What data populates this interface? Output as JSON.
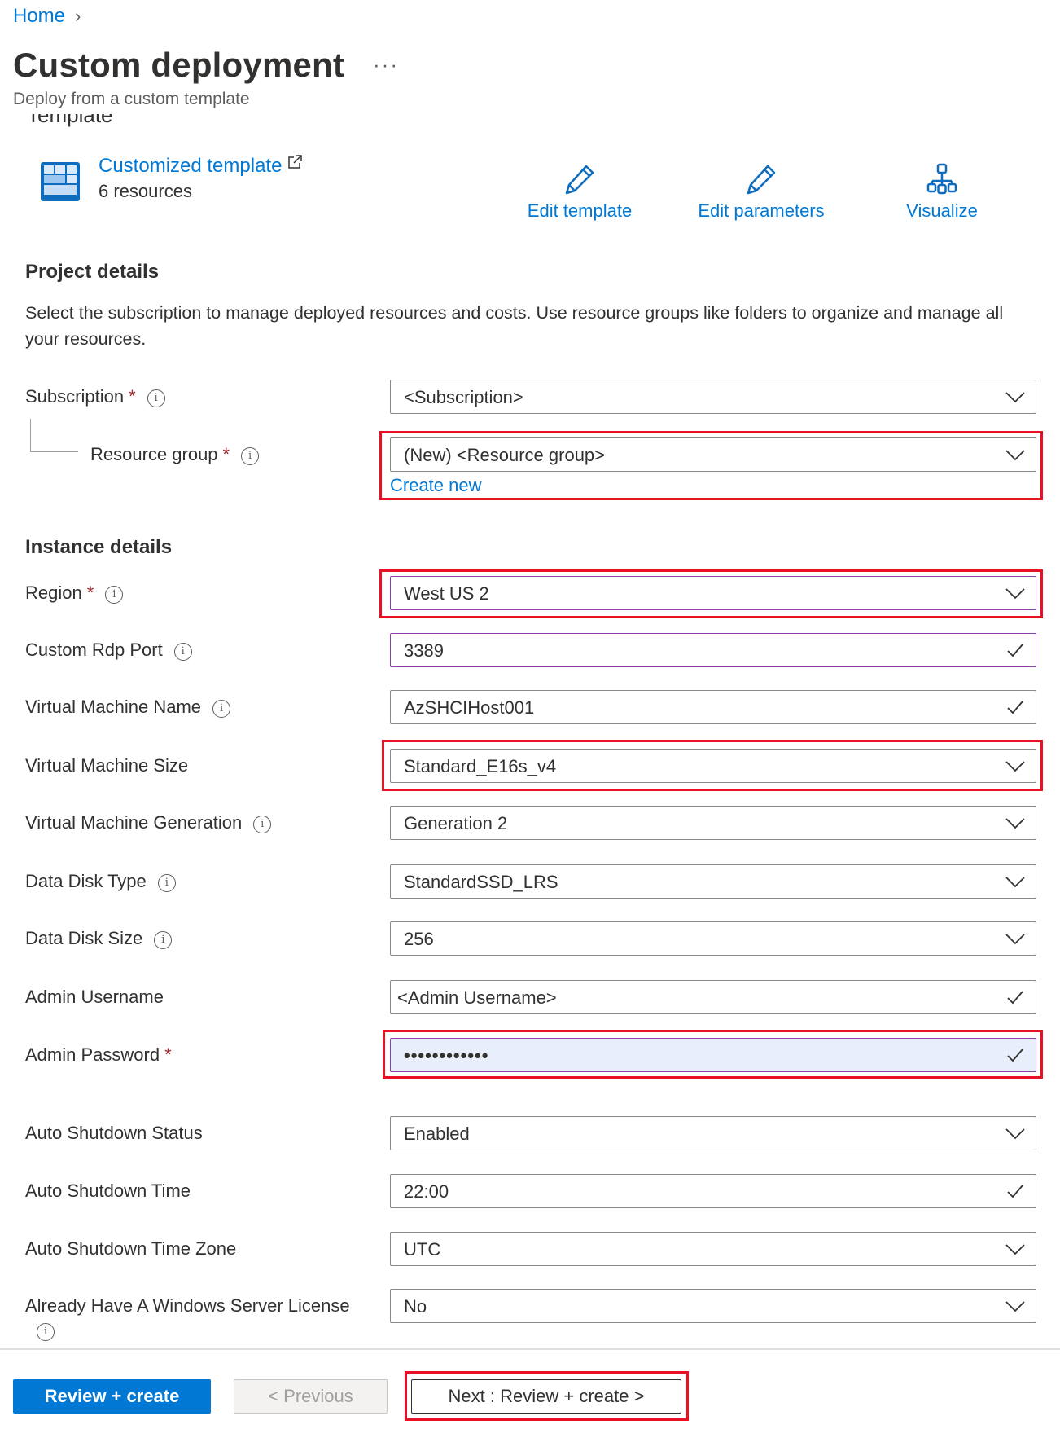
{
  "breadcrumb": {
    "home": "Home",
    "separator": "›"
  },
  "header": {
    "title": "Custom deployment",
    "more_label": "···",
    "subtitle": "Deploy from a custom template"
  },
  "template": {
    "section_cutoff": "Template",
    "name": "Customized template",
    "resource_count": "6 resources",
    "actions": [
      {
        "label": "Edit template",
        "icon": "pencil-icon"
      },
      {
        "label": "Edit parameters",
        "icon": "pencil-icon"
      },
      {
        "label": "Visualize",
        "icon": "hierarchy-icon"
      }
    ]
  },
  "project": {
    "title": "Project details",
    "description": "Select the subscription to manage deployed resources and costs. Use resource groups like folders to organize and manage all your resources.",
    "subscription": {
      "label": "Subscription",
      "required": "*",
      "value": "<Subscription>"
    },
    "resource_group": {
      "label": "Resource group",
      "required": "*",
      "value": "(New) <Resource group>",
      "create_new": "Create new"
    }
  },
  "instance": {
    "title": "Instance details",
    "fields": [
      {
        "label": "Region",
        "required": "*",
        "info": true,
        "value": "West US 2",
        "control": "dropdown"
      },
      {
        "label": "Custom Rdp Port",
        "info": true,
        "value": "3389",
        "control": "text-valid"
      },
      {
        "label": "Virtual Machine Name",
        "info": true,
        "value": "AzSHCIHost001",
        "control": "text-valid"
      },
      {
        "label": "Virtual Machine Size",
        "info": false,
        "value": "Standard_E16s_v4",
        "control": "dropdown"
      },
      {
        "label": "Virtual Machine Generation",
        "info": true,
        "value": "Generation 2",
        "control": "dropdown"
      },
      {
        "label": "Data Disk Type",
        "info": true,
        "value": "StandardSSD_LRS",
        "control": "dropdown"
      },
      {
        "label": "Data Disk Size",
        "info": true,
        "value": "256",
        "control": "dropdown"
      },
      {
        "label": "Admin Username",
        "info": false,
        "value": "<Admin Username>",
        "control": "text-valid"
      },
      {
        "label": "Admin Password",
        "required": "*",
        "info": false,
        "value": "••••••••••••",
        "control": "password-valid"
      },
      {
        "label": "Auto Shutdown Status",
        "info": false,
        "value": "Enabled",
        "control": "dropdown"
      },
      {
        "label": "Auto Shutdown Time",
        "info": false,
        "value": "22:00",
        "control": "text-valid"
      },
      {
        "label": "Auto Shutdown Time Zone",
        "info": false,
        "value": "UTC",
        "control": "dropdown"
      },
      {
        "label": "Already Have A Windows Server License",
        "info": true,
        "value": "No",
        "control": "dropdown"
      }
    ]
  },
  "footer": {
    "review_create": "Review + create",
    "previous": "< Previous",
    "next": "Next : Review + create >"
  },
  "colors": {
    "accent": "#0078d4",
    "required": "#a4262c",
    "highlight_box": "#e81123",
    "focus_border": "#8a3fae"
  }
}
